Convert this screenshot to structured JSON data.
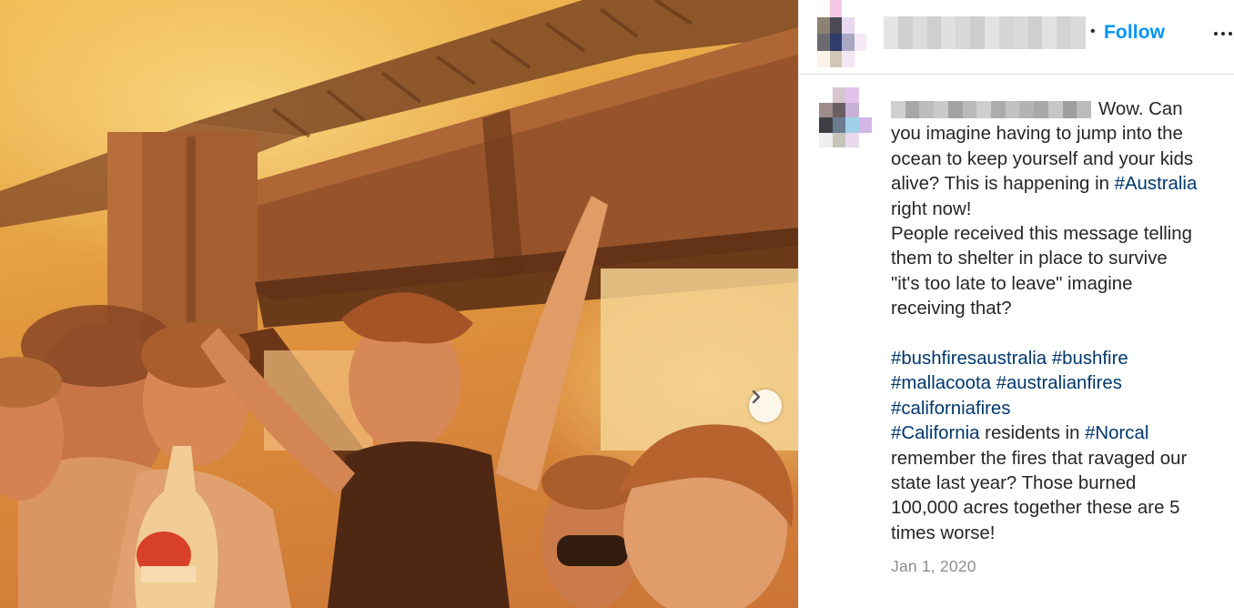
{
  "post": {
    "follow_separator": "•",
    "follow_label": "Follow",
    "more_icon": "more-horizontal-icon",
    "date": "Jan 1, 2020",
    "next_icon": "chevron-right-icon"
  },
  "caption": {
    "lines": [
      {
        "segments": [
          {
            "text": "Wow. Can"
          }
        ]
      },
      {
        "segments": [
          {
            "text": "you imagine having to jump into the"
          }
        ]
      },
      {
        "segments": [
          {
            "text": "ocean to keep yourself and your kids"
          }
        ]
      },
      {
        "segments": [
          {
            "text": "alive? This is happening in "
          },
          {
            "text": "#Australia",
            "tag": true
          }
        ]
      },
      {
        "segments": [
          {
            "text": "right now!"
          }
        ]
      },
      {
        "segments": [
          {
            "text": "People received this message telling"
          }
        ]
      },
      {
        "segments": [
          {
            "text": "them to shelter in place to survive"
          }
        ]
      },
      {
        "segments": [
          {
            "text": "\"it's too late to leave\" imagine"
          }
        ]
      },
      {
        "segments": [
          {
            "text": "receiving that?"
          }
        ]
      },
      {
        "segments": []
      },
      {
        "segments": [
          {
            "text": "#bushfiresaustralia",
            "tag": true
          },
          {
            "text": " "
          },
          {
            "text": "#bushfire",
            "tag": true
          }
        ]
      },
      {
        "segments": [
          {
            "text": "#mallacoota",
            "tag": true
          },
          {
            "text": " "
          },
          {
            "text": "#australianfires",
            "tag": true
          }
        ]
      },
      {
        "segments": [
          {
            "text": "#californiafires",
            "tag": true
          }
        ]
      },
      {
        "segments": [
          {
            "text": "#California",
            "tag": true
          },
          {
            "text": " residents in "
          },
          {
            "text": "#Norcal",
            "tag": true
          }
        ]
      },
      {
        "segments": [
          {
            "text": "remember the fires that ravaged our"
          }
        ]
      },
      {
        "segments": [
          {
            "text": "state last year? Those burned"
          }
        ]
      },
      {
        "segments": [
          {
            "text": "100,000 acres together these are 5"
          }
        ]
      },
      {
        "segments": [
          {
            "text": "times worse!"
          }
        ]
      }
    ]
  },
  "colors": {
    "follow": "#0095f6",
    "hashtag": "#00376b",
    "date": "#8e8e8e",
    "header_avatar_pixels": [
      "#ffffff",
      "#f3c8e6",
      "#ffffff",
      "#ffffff",
      "#8c8273",
      "#4a4a55",
      "#e7d9f0",
      "#ffffff",
      "#6b6a6e",
      "#2f3c6e",
      "#a8a8c3",
      "#f5e9f6",
      "#fbf2ea",
      "#d1c7b6",
      "#f2e7f2",
      "#ffffff"
    ],
    "comment_avatar_pixels": [
      "#ffffff",
      "#d7c6cd",
      "#e3c3e9",
      "#ffffff",
      "#9e8c8a",
      "#6a5e63",
      "#c8b1d6",
      "#ffffff",
      "#3e3f45",
      "#6b7d8f",
      "#9fd0e6",
      "#d3b5e8",
      "#f1eef0",
      "#c6c4bb",
      "#e9d8ee",
      "#ffffff"
    ],
    "header_name_pixels": [
      "#e4e4e4",
      "#d0d0d0",
      "#dcdcdc",
      "#cfcfcf",
      "#e0e0e0",
      "#d8d8d8",
      "#cdcdcd",
      "#e3e3e3",
      "#d5d5d5",
      "#d9d9d9",
      "#cfcfcf",
      "#e2e2e2",
      "#d3d3d3",
      "#dbdbdb"
    ],
    "comment_name_pixels": [
      "#cfcfcf",
      "#a7a7a7",
      "#bdbdbd",
      "#c9c9c9",
      "#a2a2a2",
      "#b9b9b9",
      "#cecece",
      "#acacac",
      "#c2c2c2",
      "#b3b3b3",
      "#a9a9a9",
      "#c6c6c6",
      "#9f9f9f",
      "#bbbbbb"
    ]
  }
}
